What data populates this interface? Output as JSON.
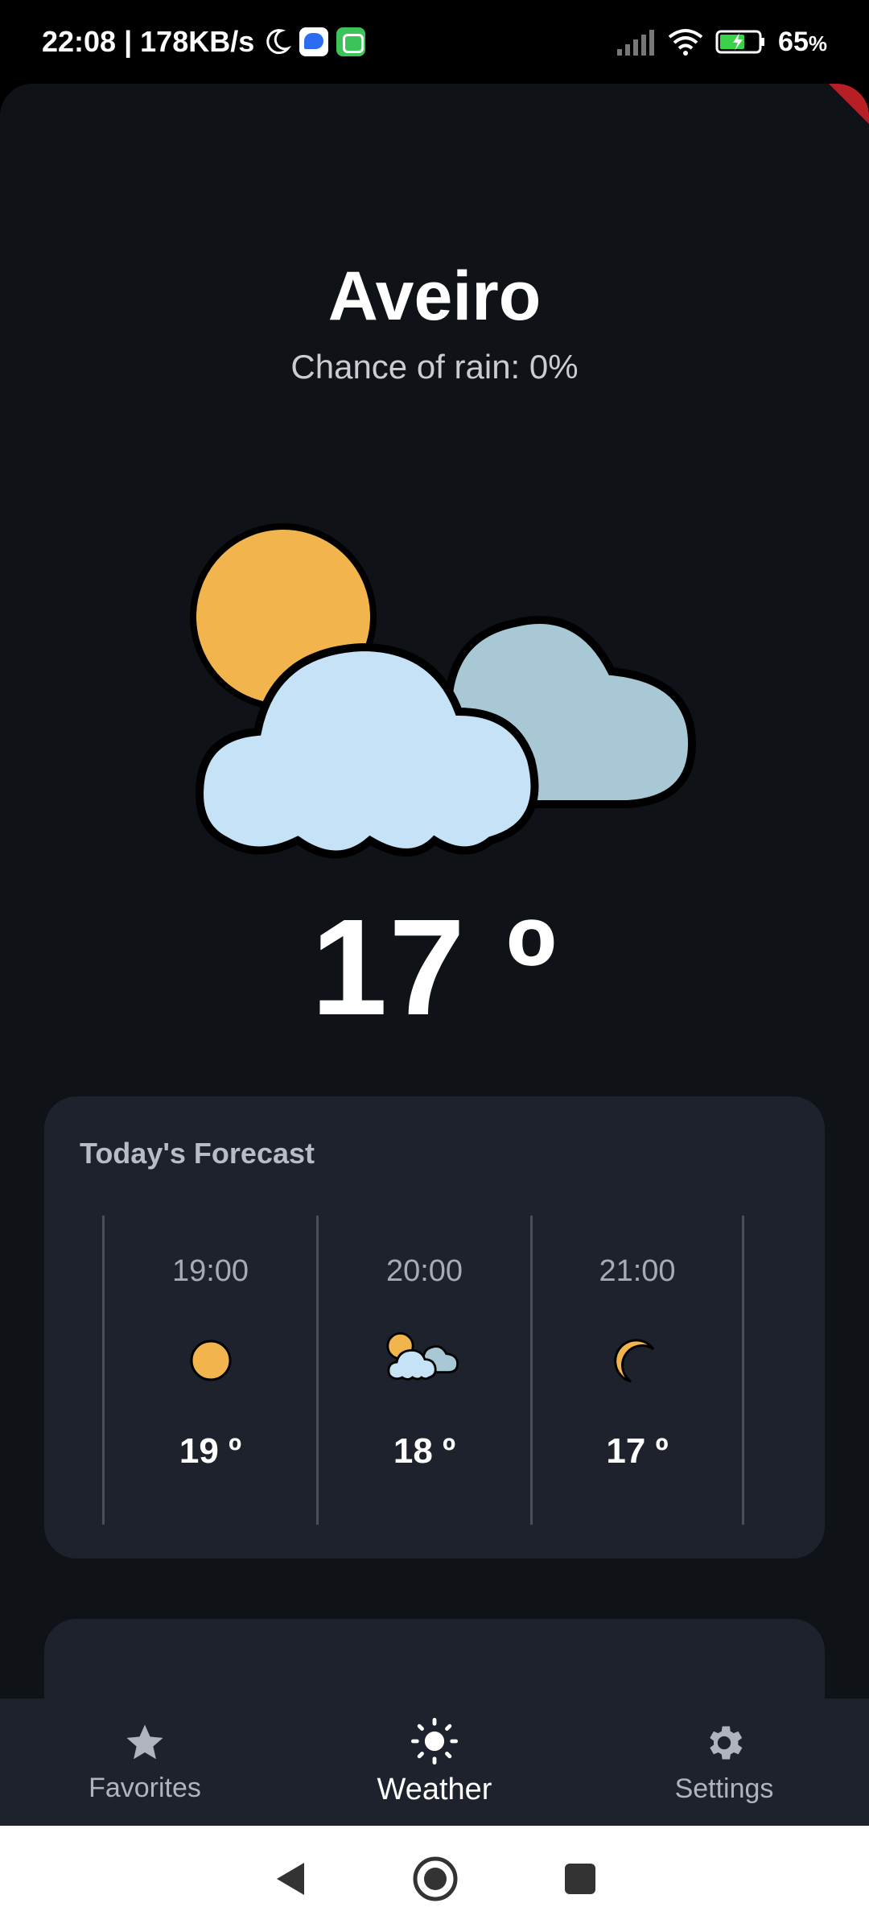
{
  "status_bar": {
    "time_speed": "22:08 | 178KB/s",
    "battery": "65",
    "battery_unit": "%"
  },
  "weather": {
    "city": "Aveiro",
    "chance_of_rain": "Chance of rain: 0%",
    "temperature": "17 º",
    "condition_icon": "partly-cloudy-icon"
  },
  "forecast": {
    "title": "Today's Forecast",
    "hours": [
      {
        "time": "19:00",
        "icon": "sun-icon",
        "temp": "19 º"
      },
      {
        "time": "20:00",
        "icon": "partly-cloudy-icon",
        "temp": "18 º"
      },
      {
        "time": "21:00",
        "icon": "moon-icon",
        "temp": "17 º"
      }
    ]
  },
  "nav": {
    "items": [
      {
        "label": "Favorites",
        "icon": "star-icon"
      },
      {
        "label": "Weather",
        "icon": "sun-icon"
      },
      {
        "label": "Settings",
        "icon": "gear-icon"
      }
    ],
    "active": "Weather"
  },
  "colors": {
    "background": "#0f1217",
    "card": "#1d222d",
    "sun": "#f2b54e",
    "cloud_front": "#c6e2f6",
    "cloud_back": "#a9c8d6"
  }
}
